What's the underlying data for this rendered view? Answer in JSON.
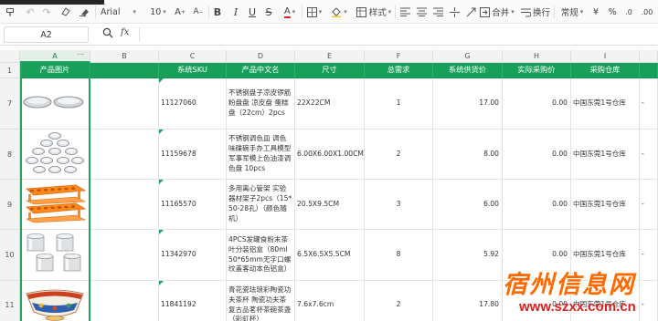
{
  "toolbar": {
    "font_name": "Arial",
    "font_size": "10",
    "styles_label": "样式",
    "merge_label": "合并",
    "wrap_label": "换行",
    "format_label": "常规",
    "currency_symbol": "¥",
    "percent_symbol": "%"
  },
  "formula_bar": {
    "cell_ref": "A2",
    "fx_label": "fx",
    "value": ""
  },
  "columns": [
    "A",
    "B",
    "C",
    "D",
    "E",
    "F",
    "G",
    "H",
    "I"
  ],
  "header_row": {
    "row_number": "1",
    "cells": [
      "产品图片",
      "",
      "系统SKU",
      "产品中文名",
      "尺寸",
      "总需求",
      "系统供货价",
      "实际采购价",
      "采购仓库"
    ]
  },
  "rows": [
    {
      "row_number": "7",
      "image": "bowl-plates",
      "sku": "11127060",
      "name": "不锈钢盘子凉皮锣筋粉盘盘 凉皮盘 蛋糕盘（22cm）2pcs",
      "size": "22X22CM",
      "demand": "1",
      "supply_price": "17.00",
      "actual_price": "0.00",
      "warehouse": "中国东莞1号仓库",
      "extra": "-"
    },
    {
      "row_number": "8",
      "image": "dip-bowls",
      "sku": "11159678",
      "name": "不锈钢调色皿 调色味碟碗手办工具模型军事军模上色油漆调色盘 10pcs",
      "size": "6.00X6.00X1.00CM",
      "demand": "2",
      "supply_price": "8.00",
      "actual_price": "0.00",
      "warehouse": "中国东莞1号仓库",
      "extra": "-"
    },
    {
      "row_number": "9",
      "image": "tube-racks",
      "sku": "11165570",
      "name": "多用离心管架 实验器材架子2pcs（15*50-28孔）（颜色随机）",
      "size": "20.5X9.5CM",
      "demand": "3",
      "supply_price": "6.00",
      "actual_price": "0.00",
      "warehouse": "中国东莞1号仓库",
      "extra": "-"
    },
    {
      "row_number": "10",
      "image": "tins",
      "sku": "11342970",
      "name": "4PCS发罐食粉末茶叶分装铝盒（80ml 50*65mm无字口螺纹盖客动本色铝盒）",
      "size": "6.5X6.5X5.5CM",
      "demand": "8",
      "supply_price": "5.92",
      "actual_price": "0.00",
      "warehouse": "中国东莞1号仓库",
      "extra": "-"
    },
    {
      "row_number": "11",
      "image": "tea-bowl",
      "sku": "11841192",
      "name": "青花瓷珐琅彩陶瓷功夫茶杯 陶瓷功夫茶复古品茗杯茶碗茶盏（彩虹杯）",
      "size": "7.6x7.6cm",
      "demand": "2",
      "supply_price": "17.80",
      "actual_price": "0.00",
      "warehouse": "中国东莞1号仓库",
      "extra": "-"
    }
  ],
  "watermark": {
    "cn": "宿州信息网",
    "url": "www.szxx.com.cn"
  },
  "colors": {
    "header_green": "#18a05a",
    "selection_green": "#21a366",
    "watermark_orange": "#ff6a00"
  }
}
